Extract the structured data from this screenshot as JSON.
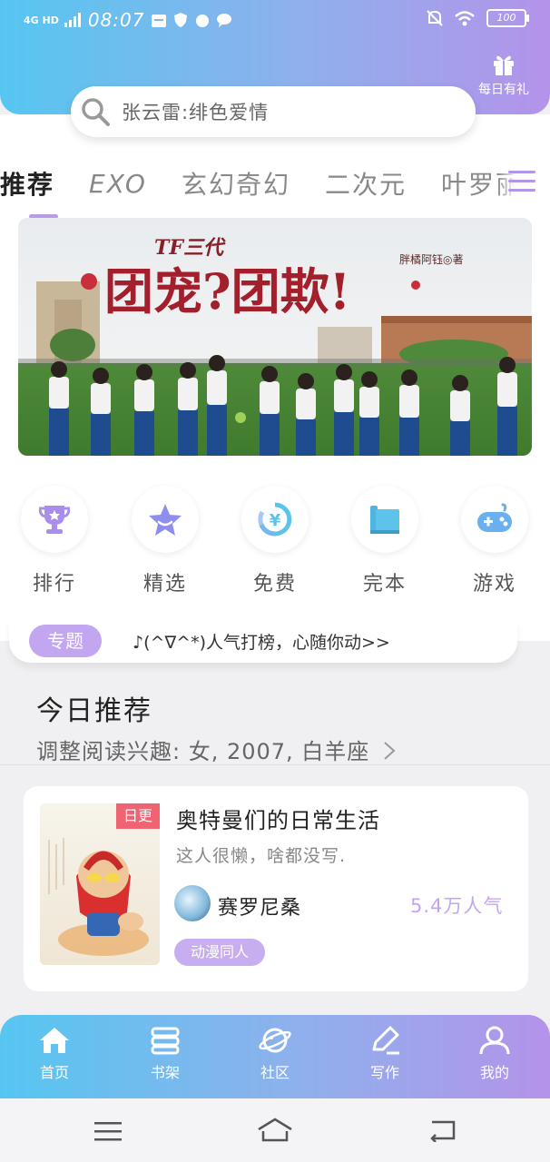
{
  "status_bar": {
    "network": "4G HD",
    "time": "08:07",
    "battery": "100"
  },
  "header": {
    "gift_label": "每日有礼"
  },
  "search": {
    "placeholder": "张云雷:绯色爱情"
  },
  "tabs": [
    {
      "label": "推荐"
    },
    {
      "label": "EXO"
    },
    {
      "label": "玄幻奇幻"
    },
    {
      "label": "二次元"
    },
    {
      "label": "叶罗丽"
    }
  ],
  "banner": {
    "series": "TF三代",
    "title": "团宠?团欺!",
    "author": "胖橘阿钰◎著"
  },
  "categories": [
    {
      "label": "排行",
      "icon": "trophy-icon"
    },
    {
      "label": "精选",
      "icon": "star-icon"
    },
    {
      "label": "免费",
      "icon": "yen-icon"
    },
    {
      "label": "完本",
      "icon": "book-icon"
    },
    {
      "label": "游戏",
      "icon": "gamepad-icon"
    }
  ],
  "topic": {
    "badge": "专题",
    "text": "♪(^∇^*)人气打榜，心随你动>>"
  },
  "recommend": {
    "title": "今日推荐",
    "subtitle": "调整阅读兴趣: 女, 2007, 白羊座"
  },
  "book": {
    "badge": "日更",
    "title": "奥特曼们的日常生活",
    "description": "这人很懒，啥都没写.",
    "author": "赛罗尼桑",
    "popularity": "5.4万人气",
    "tag": "动漫同人"
  },
  "bottom_nav": [
    {
      "label": "首页",
      "icon": "home-icon"
    },
    {
      "label": "书架",
      "icon": "bookshelf-icon"
    },
    {
      "label": "社区",
      "icon": "planet-icon"
    },
    {
      "label": "写作",
      "icon": "pen-icon"
    },
    {
      "label": "我的",
      "icon": "user-icon"
    }
  ],
  "colors": {
    "accent_start": "#56c6f0",
    "accent_end": "#b493ea",
    "badge_purple": "#c3a6f0",
    "daily_red": "#ef6372"
  }
}
